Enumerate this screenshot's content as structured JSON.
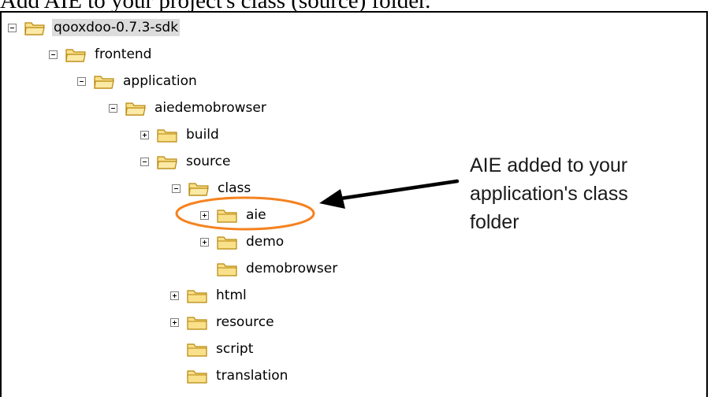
{
  "heading": "Add AIE to your project's class (source) folder.",
  "tree": [
    {
      "label": "qooxdoo-0.7.3-sdk",
      "toggle": "minus",
      "selected": true
    },
    {
      "label": "frontend",
      "toggle": "minus",
      "selected": false
    },
    {
      "label": "application",
      "toggle": "minus",
      "selected": false
    },
    {
      "label": "aiedemobrowser",
      "toggle": "minus",
      "selected": false
    },
    {
      "label": "build",
      "toggle": "plus",
      "selected": false
    },
    {
      "label": "source",
      "toggle": "minus",
      "selected": false
    },
    {
      "label": "class",
      "toggle": "minus",
      "selected": false
    },
    {
      "label": "aie",
      "toggle": "plus",
      "selected": false
    },
    {
      "label": "demo",
      "toggle": "plus",
      "selected": false
    },
    {
      "label": "demobrowser",
      "toggle": "none",
      "selected": false
    },
    {
      "label": "html",
      "toggle": "plus",
      "selected": false
    },
    {
      "label": "resource",
      "toggle": "plus",
      "selected": false
    },
    {
      "label": "script",
      "toggle": "none",
      "selected": false
    },
    {
      "label": "translation",
      "toggle": "none",
      "selected": false
    }
  ],
  "annotation": {
    "lines": [
      "AIE added to your",
      "application's class",
      "folder"
    ]
  },
  "colors": {
    "highlight_ellipse": "#f5821f",
    "arrow": "#000000",
    "folder_fill": "#f9e08a",
    "folder_outline": "#b8860b"
  }
}
